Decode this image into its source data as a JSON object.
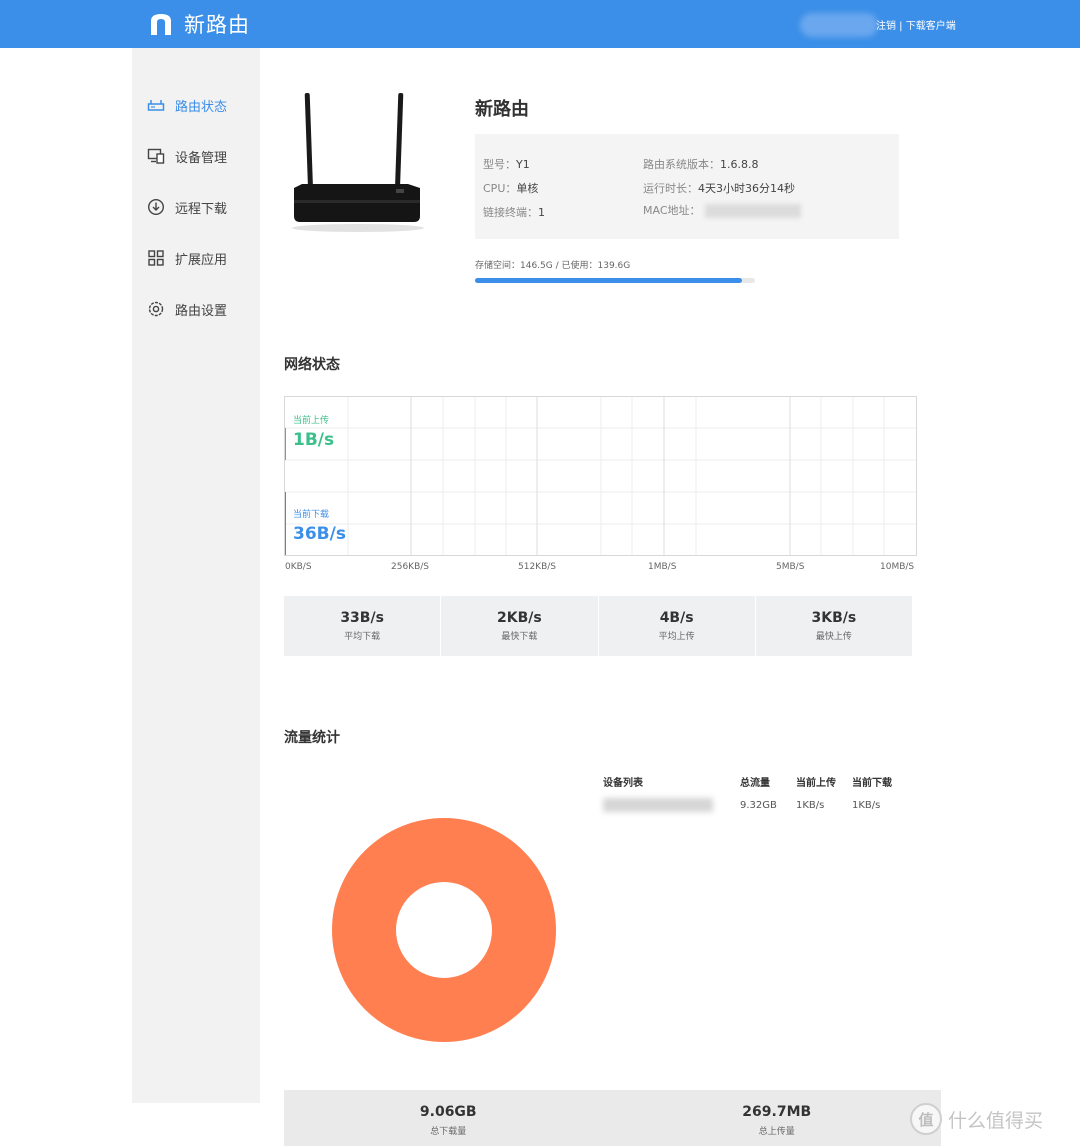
{
  "header": {
    "logo_text": "新路由",
    "logout_label": "注销",
    "separator": " | ",
    "download_client_label": "下载客户端"
  },
  "sidebar": {
    "items": [
      {
        "label": "路由状态",
        "icon": "router-icon",
        "active": true
      },
      {
        "label": "设备管理",
        "icon": "devices-icon",
        "active": false
      },
      {
        "label": "远程下载",
        "icon": "download-icon",
        "active": false
      },
      {
        "label": "扩展应用",
        "icon": "apps-grid-icon",
        "active": false
      },
      {
        "label": "路由设置",
        "icon": "settings-icon",
        "active": false
      }
    ]
  },
  "device": {
    "title": "新路由",
    "model_label": "型号：",
    "model_value": "Y1",
    "cpu_label": "CPU：",
    "cpu_value": "单核",
    "clients_label": "链接终端：",
    "clients_value": "1",
    "firmware_label": "路由系统版本：",
    "firmware_value": "1.6.8.8",
    "uptime_label": "运行时长：",
    "uptime_value": "4天3小时36分14秒",
    "mac_label": "MAC地址："
  },
  "storage": {
    "text": "存储空间：146.5G / 已使用：139.6G",
    "used_fraction": 0.953,
    "color": "#3b8fe8"
  },
  "network": {
    "title": "网络状态",
    "upload_label": "当前上传",
    "upload_value": "1B/s",
    "upload_color": "#3cc08b",
    "download_label": "当前下载",
    "download_value": "36B/s",
    "download_color": "#3b8fe8",
    "axis_ticks": [
      "0KB/S",
      "256KB/S",
      "512KB/S",
      "1MB/S",
      "5MB/S",
      "10MB/S"
    ]
  },
  "stats": [
    {
      "value": "33B/s",
      "label": "平均下载"
    },
    {
      "value": "2KB/s",
      "label": "最快下载"
    },
    {
      "value": "4B/s",
      "label": "平均上传"
    },
    {
      "value": "3KB/s",
      "label": "最快上传"
    }
  ],
  "traffic": {
    "title": "流量统计",
    "donut_color": "#ff7f50",
    "table_headers": [
      "设备列表",
      "总流量",
      "当前上传",
      "当前下载"
    ],
    "rows": [
      {
        "total": "9.32GB",
        "upload": "1KB/s",
        "download": "1KB/s"
      }
    ]
  },
  "totals": [
    {
      "value": "9.06GB",
      "label": "总下载量"
    },
    {
      "value": "269.7MB",
      "label": "总上传量"
    }
  ],
  "watermark": {
    "circle_text": "值",
    "text": "什么值得买"
  }
}
